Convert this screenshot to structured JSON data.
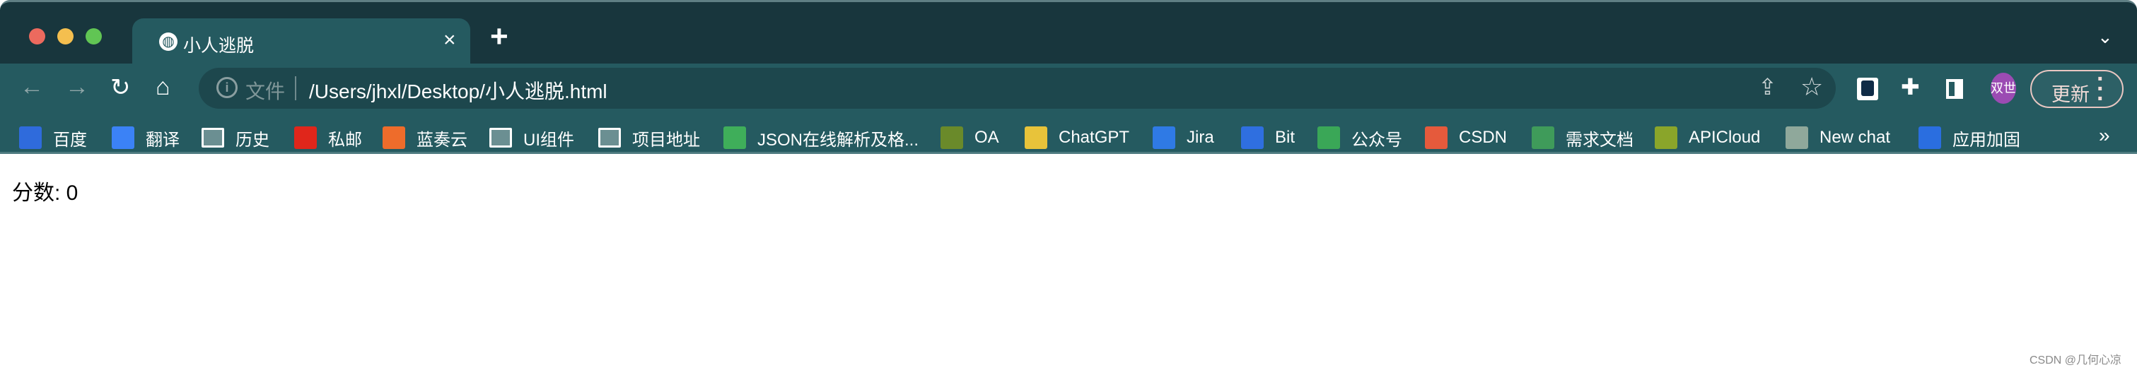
{
  "tab": {
    "title": "小人逃脱",
    "icon": "globe-icon"
  },
  "toolbar": {
    "file_label": "文件",
    "url": "/Users/jhxl/Desktop/小人逃脱.html",
    "avatar_text": "双世",
    "update_label": "更新"
  },
  "bookmarks": [
    {
      "label": "百度",
      "icon": "baidu-icon",
      "color": "#2f6bdc"
    },
    {
      "label": "翻译",
      "icon": "translate-icon",
      "color": "#3b82f6"
    },
    {
      "label": "历史",
      "icon": "folder-icon",
      "color": "#6b8f92"
    },
    {
      "label": "私邮",
      "icon": "mail-icon",
      "color": "#e0261b"
    },
    {
      "label": "蓝奏云",
      "icon": "lanzou-icon",
      "color": "#ee6c2b"
    },
    {
      "label": "UI组件",
      "icon": "folder-icon",
      "color": "#6b8f92"
    },
    {
      "label": "项目地址",
      "icon": "folder-icon",
      "color": "#6b8f92"
    },
    {
      "label": "JSON在线解析及格...",
      "icon": "json-icon",
      "color": "#3fae5a"
    },
    {
      "label": "OA",
      "icon": "oa-icon",
      "color": "#6a8a2a"
    },
    {
      "label": "ChatGPT",
      "icon": "robot-icon",
      "color": "#e8c33a"
    },
    {
      "label": "Jira",
      "icon": "jira-icon",
      "color": "#2f7ae5"
    },
    {
      "label": "Bit",
      "icon": "bit-icon",
      "color": "#2f6fe0"
    },
    {
      "label": "公众号",
      "icon": "wechat-icon",
      "color": "#3aa757"
    },
    {
      "label": "CSDN",
      "icon": "csdn-icon",
      "color": "#e55a3c"
    },
    {
      "label": "需求文档",
      "icon": "sheet-icon",
      "color": "#3f9b5a"
    },
    {
      "label": "APICloud",
      "icon": "apicloud-icon",
      "color": "#8aa52a"
    },
    {
      "label": "New chat",
      "icon": "openai-icon",
      "color": "#8fa89b"
    },
    {
      "label": "应用加固",
      "icon": "shield-icon",
      "color": "#2a6ee0"
    }
  ],
  "content": {
    "score": "分数: 0"
  },
  "watermark": "CSDN @几何心凉"
}
